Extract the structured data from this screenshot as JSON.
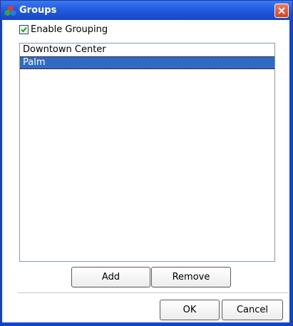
{
  "window": {
    "title": "Groups"
  },
  "grouping": {
    "label": "Enable Grouping",
    "checked": true
  },
  "groups_list": {
    "items": [
      "Downtown Center",
      "Palm"
    ],
    "selected_index": 1
  },
  "list_actions": {
    "add_label": "Add",
    "remove_label": "Remove"
  },
  "dialog_actions": {
    "ok_label": "OK",
    "cancel_label": "Cancel"
  },
  "colors": {
    "selection": "#316ac5",
    "titlebar": "#1d52d6",
    "close": "#d4401f"
  }
}
